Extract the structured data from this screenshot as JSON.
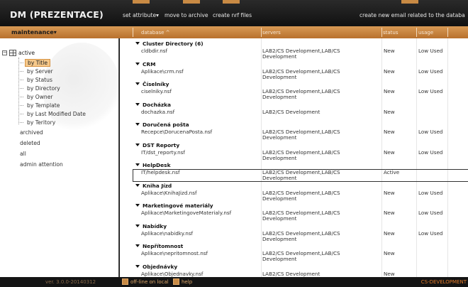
{
  "app": {
    "title": "DM (PREZENTACE)",
    "actions": [
      "set attribute▾",
      "move to archive",
      "create nrf files"
    ],
    "right_action": "create new email related to the databa"
  },
  "bar": {
    "menu": "maintenance▾",
    "columns": {
      "database": "database ^",
      "servers": "servers",
      "status": "status",
      "usage": "usage"
    }
  },
  "sidebar": {
    "root": "active",
    "items": [
      "by Title",
      "by Server",
      "by Status",
      "by Directory",
      "by Owner",
      "by Template",
      "by Last Modified Date",
      "by Teritory"
    ],
    "selected": "by Title",
    "other": [
      "archived",
      "deleted",
      "all",
      "admin attention"
    ]
  },
  "rows": [
    {
      "category": "Cluster Directory (6)",
      "path": "cldbdir.nsf",
      "servers": "LAB2/CS Development,LAB/CS Development",
      "status": "New",
      "usage": "Low Used"
    },
    {
      "category": "CRM",
      "path": "Aplikace\\crm.nsf",
      "servers": "LAB2/CS Development,LAB/CS Development",
      "status": "New",
      "usage": "Low Used"
    },
    {
      "category": "Číselníky",
      "path": "ciselniky.nsf",
      "servers": "LAB2/CS Development,LAB/CS Development",
      "status": "New",
      "usage": "Low Used"
    },
    {
      "category": "Docházka",
      "path": "dochazka.nsf",
      "servers": "LAB2/CS Development",
      "status": "New",
      "usage": ""
    },
    {
      "category": "Doručená pošta",
      "path": "Recepce\\DorucenaPosta.nsf",
      "servers": "LAB2/CS Development,LAB/CS Development",
      "status": "New",
      "usage": "Low Used"
    },
    {
      "category": "DST Reporty",
      "path": "IT/dst_reporty.nsf",
      "servers": "LAB2/CS Development,LAB/CS Development",
      "status": "New",
      "usage": "Low Used"
    },
    {
      "category": "HelpDesk",
      "path": "IT/helpdesk.nsf",
      "servers": "LAB2/CS Development,LAB/CS Development",
      "status": "Active",
      "usage": ""
    },
    {
      "category": "Kniha Jízd",
      "path": "Aplikace\\KnihaJizd.nsf",
      "servers": "LAB2/CS Development,LAB/CS Development",
      "status": "New",
      "usage": "Low Used"
    },
    {
      "category": "Marketingové materiály",
      "path": "Aplikace\\MarketingoveMaterialy.nsf",
      "servers": "LAB2/CS Development,LAB/CS Development",
      "status": "New",
      "usage": "Low Used"
    },
    {
      "category": "Nabídky",
      "path": "Aplikace\\nabidky.nsf",
      "servers": "LAB2/CS Development,LAB/CS Development",
      "status": "New",
      "usage": "Low Used"
    },
    {
      "category": "Nepřítomnost",
      "path": "Aplikace\\nepritomnost.nsf",
      "servers": "LAB2/CS Development,LAB/CS Development",
      "status": "New",
      "usage": ""
    },
    {
      "category": "Objednávky",
      "path": "Aplikace\\Objednavky.nsf",
      "servers": "LAB2/CS Development",
      "status": "New",
      "usage": ""
    }
  ],
  "footer": {
    "version": "ver. 3.0.0-20140312",
    "offline": "off-line on local",
    "help": "help",
    "right": "CS-DEVELOPMENT"
  }
}
